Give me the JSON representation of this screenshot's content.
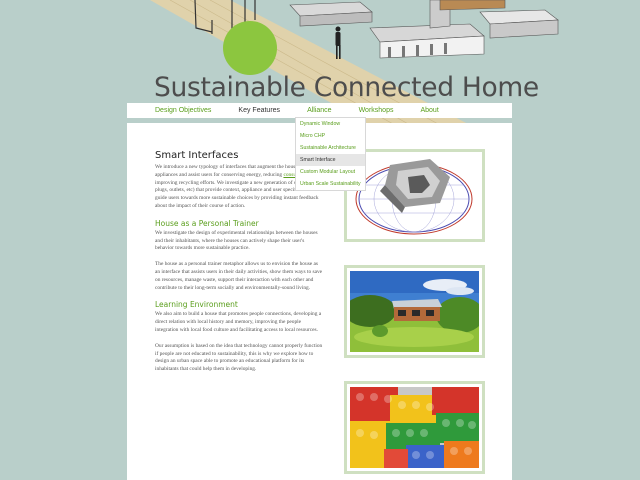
{
  "site": {
    "title": "Sustainable Connected Home"
  },
  "nav": {
    "items": [
      {
        "label": "Design Objectives",
        "active": false
      },
      {
        "label": "Key Features",
        "active": true
      },
      {
        "label": "Alliance",
        "active": false
      },
      {
        "label": "Workshops",
        "active": false
      },
      {
        "label": "About",
        "active": false
      }
    ],
    "dropdown": [
      {
        "label": "Dynamic Window"
      },
      {
        "label": "Micro CHP"
      },
      {
        "label": "Sustainable Architecture"
      },
      {
        "label": "Smart Interface",
        "selected": true
      },
      {
        "label": "Custom Modular Layout"
      },
      {
        "label": "Urban Scale Sustainability"
      }
    ]
  },
  "article": {
    "title": "Smart Interfaces",
    "intro": {
      "before": "We introduce a new typology of interfaces that augment the household appliances and assist users for conserving energy, reducing ",
      "link": "consumption",
      "after": " and improving recycling efforts. We investigate a new generation of devices (e.g., plugs, outlets, etc) that provide context, appliance and user specific choices to guide users towards more sustainable choices by providing instant feedback about the impact of their course of action."
    },
    "sections": [
      {
        "heading": "House as a Personal Trainer",
        "paragraphs": [
          "We investigate the design of experimental relationships between the houses and their inhabitants, where the houses can actively shape their user's behavior towards more sustainable practice.",
          "The house as a personal trainer metaphor allows us to envision the house as an interface that assists users in their daily activities, show them ways to save on resources, manage waste, support their interaction with each other and contribute to their long-term socially and environmentally-sound living."
        ]
      },
      {
        "heading": "Learning Environment",
        "paragraphs": [
          "We also aim to build a house that promotes people connections, developing a direct relation with local history and memory, improving the people integration with local food culture and facilitating access to local resources.",
          "Our assumption is based on the idea that technology cannot properly function if people are not educated to sustainability, this is why we explore how to design an urban space able to promote an educational platform for its inhabitants that could help them in developing."
        ]
      }
    ]
  },
  "theme": {
    "background": "#b9cfca",
    "accent": "#5a9e1c",
    "photo_border": "#cfe0c1"
  }
}
